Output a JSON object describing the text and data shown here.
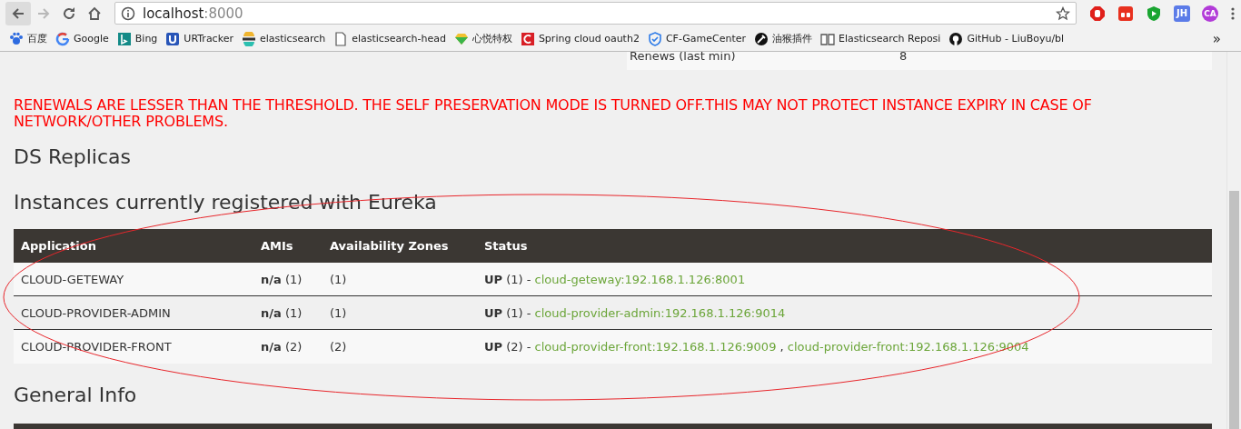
{
  "browser": {
    "nav_buttons": [
      {
        "kind": "back",
        "disabled": false
      },
      {
        "kind": "forward",
        "disabled": true
      },
      {
        "kind": "reload",
        "disabled": false
      },
      {
        "kind": "home",
        "disabled": false
      }
    ],
    "address": {
      "host": "localhost",
      "port": ":8000"
    },
    "extensions": [
      {
        "kind": "hand"
      },
      {
        "kind": "square"
      },
      {
        "kind": "shield"
      },
      {
        "kind": "letters",
        "label": "JH"
      },
      {
        "kind": "circle-letters",
        "label": "CA"
      }
    ],
    "bookmarks": [
      {
        "kind": "paw",
        "label": "百度"
      },
      {
        "kind": "g",
        "label": "Google"
      },
      {
        "kind": "b",
        "label": "Bing"
      },
      {
        "kind": "u",
        "label": "URTracker"
      },
      {
        "kind": "stripes",
        "label": "elasticsearch"
      },
      {
        "kind": "page",
        "label": "elasticsearch-head"
      },
      {
        "kind": "gem",
        "label": "心悦特权"
      },
      {
        "kind": "c",
        "label": "Spring cloud oauth2"
      },
      {
        "kind": "shield",
        "label": "CF-GameCenter"
      },
      {
        "kind": "dark",
        "label": "油猴插件"
      },
      {
        "kind": "book",
        "label": "Elasticsearch Reposi"
      },
      {
        "kind": "octo",
        "label": "GitHub - LiuBoyu/bl"
      }
    ],
    "bookmarks_overflow": "»"
  },
  "summary_row": {
    "label": "Renews (last min)",
    "value": "8"
  },
  "warning": "RENEWALS ARE LESSER THAN THE THRESHOLD. THE SELF PRESERVATION MODE IS TURNED OFF.THIS MAY NOT PROTECT INSTANCE EXPIRY IN CASE OF NETWORK/OTHER PROBLEMS.",
  "ds_replicas_heading": "DS Replicas",
  "instances": {
    "heading": "Instances currently registered with Eureka",
    "columns": [
      "Application",
      "AMIs",
      "Availability Zones",
      "Status"
    ],
    "rows": [
      {
        "application": "CLOUD-GETEWAY",
        "amis": "**n/a** (1)",
        "zones": "(1)",
        "status": "**UP** (1) - ",
        "links": [
          "cloud-geteway:192.168.1.126:8001"
        ]
      },
      {
        "application": "CLOUD-PROVIDER-ADMIN",
        "amis": "**n/a** (1)",
        "zones": "(1)",
        "status": "**UP** (1) - ",
        "links": [
          "cloud-provider-admin:192.168.1.126:9014"
        ]
      },
      {
        "application": "CLOUD-PROVIDER-FRONT",
        "amis": "**n/a** (2)",
        "zones": "(2)",
        "status": "**UP** (2) - ",
        "links": [
          "cloud-provider-front:192.168.1.126:9009",
          "cloud-provider-front:192.168.1.126:9004"
        ],
        "link_separator": ","
      }
    ]
  },
  "general_info_heading": "General Info"
}
